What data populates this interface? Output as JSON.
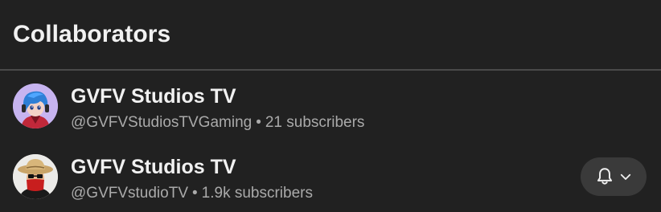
{
  "header": {
    "title": "Collaborators"
  },
  "collaborators": [
    {
      "name": "GVFV Studios TV",
      "handle": "@GVFVStudiosTVGaming",
      "separator": "•",
      "subscribers": "21 subscribers",
      "avatar_icon": "avatar-anime-blue-hair"
    },
    {
      "name": "GVFV Studios TV",
      "handle": "@GVFVstudioTV",
      "separator": "•",
      "subscribers": "1.9k subscribers",
      "avatar_icon": "avatar-straw-hat-red-mask",
      "notify_button": {
        "icons": [
          "bell-icon",
          "chevron-down-icon"
        ]
      }
    }
  ],
  "colors": {
    "background": "#212121",
    "text_primary": "#f1f1f1",
    "text_secondary": "#aaaaaa",
    "divider": "#4a4a4a",
    "button_bg": "#3a3a3a"
  }
}
